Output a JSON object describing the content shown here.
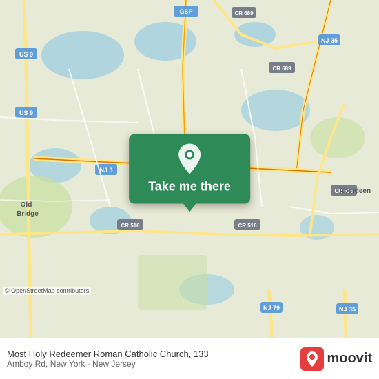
{
  "map": {
    "background_color": "#e8ead8",
    "attribution": "© OpenStreetMap contributors"
  },
  "popup": {
    "button_label": "Take me there",
    "pin_icon": "location-pin"
  },
  "bottom_bar": {
    "church_name": "Most Holy Redeemer Roman Catholic Church, 133",
    "church_address": "Amboy Rd, New York - New Jersey",
    "moovit_label": "moovit"
  }
}
